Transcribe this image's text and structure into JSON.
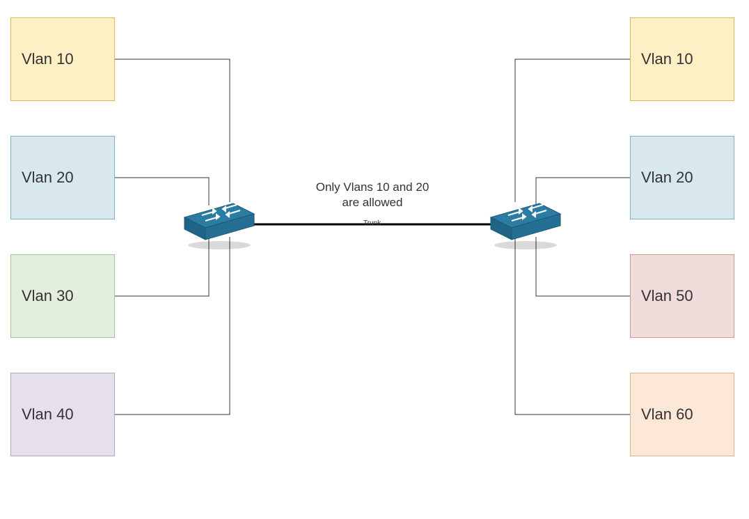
{
  "left_vlans": [
    {
      "label": "Vlan 10",
      "color": "yellow"
    },
    {
      "label": "Vlan 20",
      "color": "blue"
    },
    {
      "label": "Vlan 30",
      "color": "green"
    },
    {
      "label": "Vlan 40",
      "color": "purple"
    }
  ],
  "right_vlans": [
    {
      "label": "Vlan 10",
      "color": "yellow"
    },
    {
      "label": "Vlan 20",
      "color": "blue"
    },
    {
      "label": "Vlan 50",
      "color": "pink"
    },
    {
      "label": "Vlan 60",
      "color": "peach"
    }
  ],
  "center": {
    "line1": "Only Vlans 10 and 20",
    "line2": "are allowed",
    "trunk": "Trunk"
  }
}
